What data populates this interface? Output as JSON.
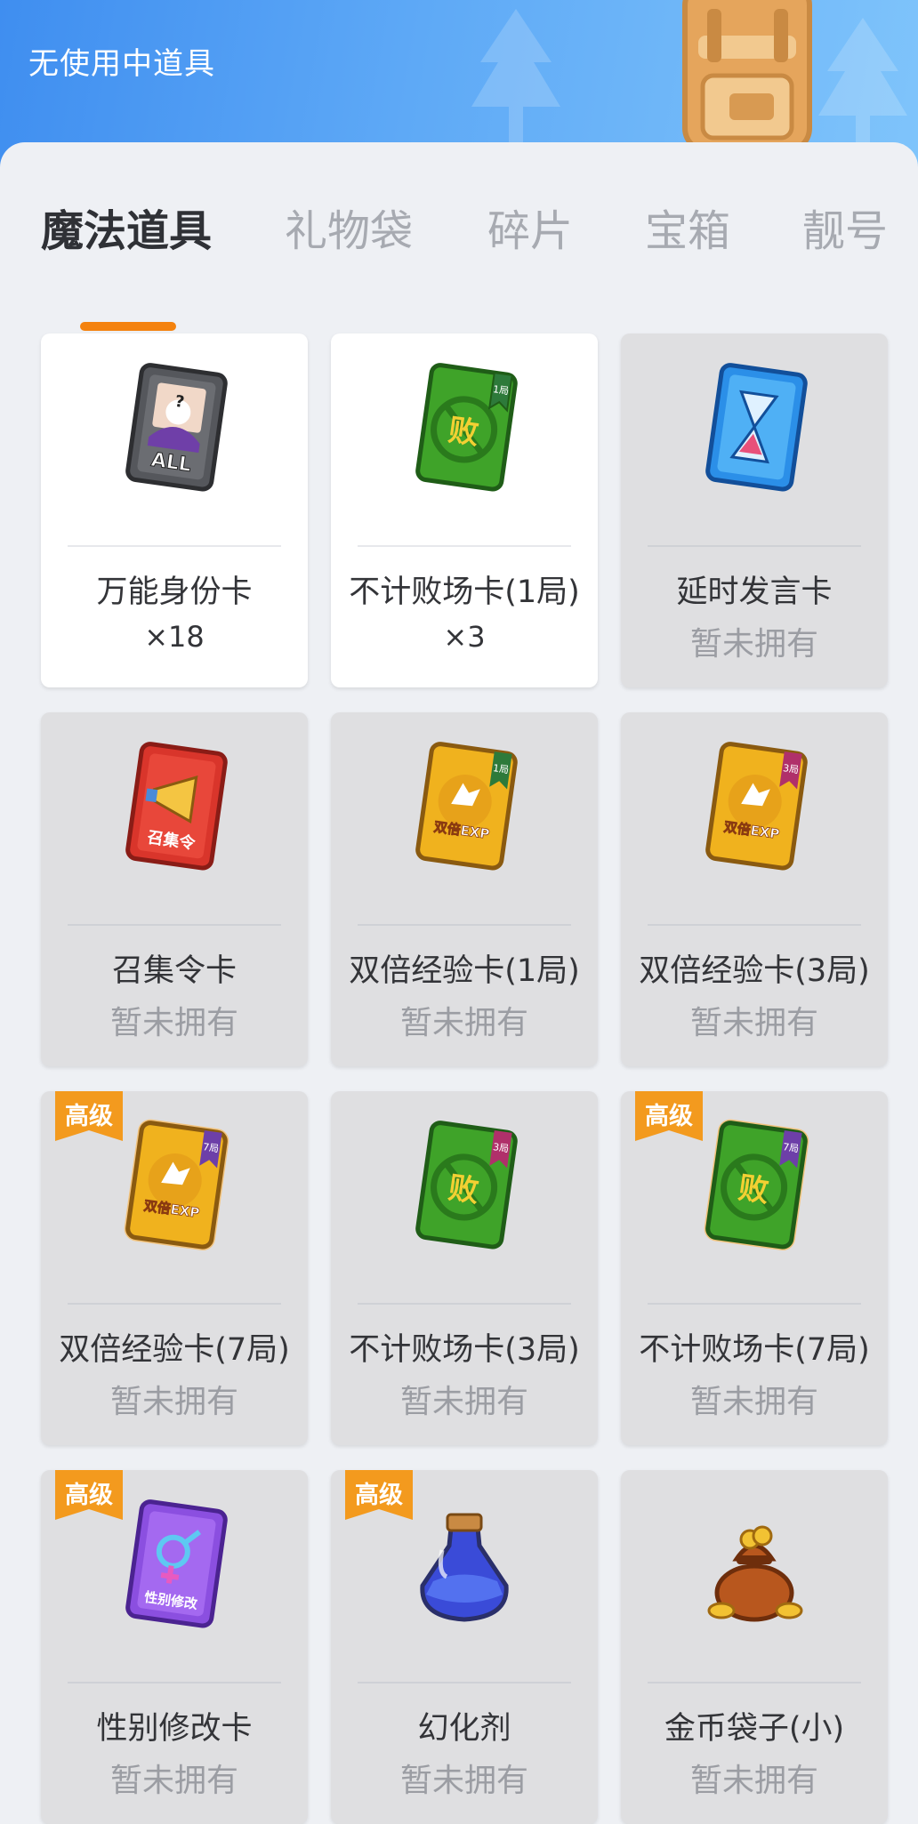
{
  "header": {
    "status_text": "无使用中道具"
  },
  "tabs": [
    {
      "label": "魔法道具",
      "active": true
    },
    {
      "label": "礼物袋",
      "active": false
    },
    {
      "label": "碎片",
      "active": false
    },
    {
      "label": "宝箱",
      "active": false
    },
    {
      "label": "靓号",
      "active": false
    }
  ],
  "colors": {
    "accent": "#f4820e",
    "header_blue": "#4a97f2",
    "badge_orange": "#f39a1e"
  },
  "items": [
    {
      "name": "万能身份卡",
      "count": "×18",
      "status": "",
      "badge": "",
      "icon": "universal-identity-card-icon"
    },
    {
      "name": "不计败场卡(1局)",
      "count": "×3",
      "status": "",
      "badge": "",
      "icon": "no-loss-card-icon"
    },
    {
      "name": "延时发言卡",
      "count": "",
      "status": "暂未拥有",
      "badge": "",
      "icon": "hourglass-card-icon"
    },
    {
      "name": "召集令卡",
      "count": "",
      "status": "暂未拥有",
      "badge": "",
      "icon": "megaphone-card-icon",
      "card_text": "召集令"
    },
    {
      "name": "双倍经验卡(1局)",
      "count": "",
      "status": "暂未拥有",
      "badge": "",
      "icon": "double-exp-card-icon",
      "card_text": "双倍EXP",
      "ribbon": "1局"
    },
    {
      "name": "双倍经验卡(3局)",
      "count": "",
      "status": "暂未拥有",
      "badge": "",
      "icon": "double-exp-card-icon",
      "card_text": "双倍EXP",
      "ribbon": "3局"
    },
    {
      "name": "双倍经验卡(7局)",
      "count": "",
      "status": "暂未拥有",
      "badge": "高级",
      "icon": "double-exp-card-icon",
      "card_text": "双倍EXP",
      "ribbon": "7局"
    },
    {
      "name": "不计败场卡(3局)",
      "count": "",
      "status": "暂未拥有",
      "badge": "",
      "icon": "no-loss-card-icon",
      "ribbon": "3局"
    },
    {
      "name": "不计败场卡(7局)",
      "count": "",
      "status": "暂未拥有",
      "badge": "高级",
      "icon": "no-loss-card-icon",
      "ribbon": "7局"
    },
    {
      "name": "性别修改卡",
      "count": "",
      "status": "暂未拥有",
      "badge": "高级",
      "icon": "gender-change-card-icon",
      "card_text": "性别修改"
    },
    {
      "name": "幻化剂",
      "count": "",
      "status": "暂未拥有",
      "badge": "高级",
      "icon": "potion-icon"
    },
    {
      "name": "金币袋子(小)",
      "count": "",
      "status": "暂未拥有",
      "badge": "",
      "icon": "coin-bag-icon"
    }
  ],
  "card_glyphs": {
    "all": "ALL",
    "question": "?",
    "loss": "败",
    "ribbon_1": "1局"
  }
}
